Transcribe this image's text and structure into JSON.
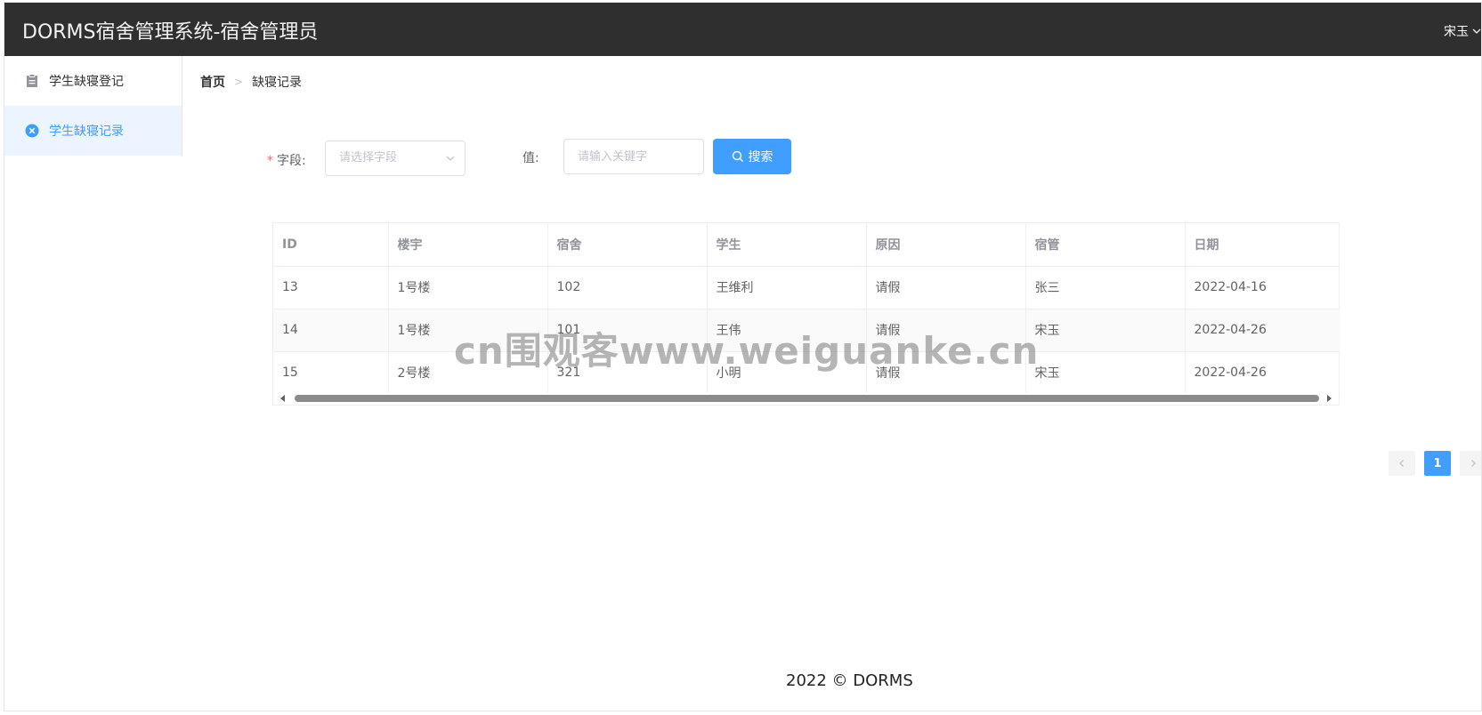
{
  "header": {
    "app_title": "DORMS宿舍管理系统-宿舍管理员",
    "user_name": "宋玉"
  },
  "sidebar": {
    "items": [
      {
        "label": "学生缺寝登记",
        "icon": "clipboard-icon",
        "active": false
      },
      {
        "label": "学生缺寝记录",
        "icon": "circle-close-icon",
        "active": true
      }
    ]
  },
  "breadcrumb": {
    "home": "首页",
    "current": "缺寝记录"
  },
  "search_form": {
    "field_label": "字段:",
    "field_placeholder": "请选择字段",
    "value_label": "值:",
    "value_placeholder": "请输入关键字",
    "search_button": "搜索"
  },
  "table": {
    "columns": [
      "ID",
      "楼宇",
      "宿舍",
      "学生",
      "原因",
      "宿管",
      "日期"
    ],
    "rows": [
      [
        "13",
        "1号楼",
        "102",
        "王维利",
        "请假",
        "张三",
        "2022-04-16"
      ],
      [
        "14",
        "1号楼",
        "101",
        "王伟",
        "请假",
        "宋玉",
        "2022-04-26"
      ],
      [
        "15",
        "2号楼",
        "321",
        "小明",
        "请假",
        "宋玉",
        "2022-04-26"
      ]
    ]
  },
  "pagination": {
    "current_page": "1"
  },
  "footer": {
    "text": "2022 © DORMS"
  },
  "watermark": "cn围观客www.weiguanke.cn",
  "colors": {
    "topbar": "#2f2f2f",
    "primary": "#409eff",
    "active_bg": "#ecf5ff"
  }
}
